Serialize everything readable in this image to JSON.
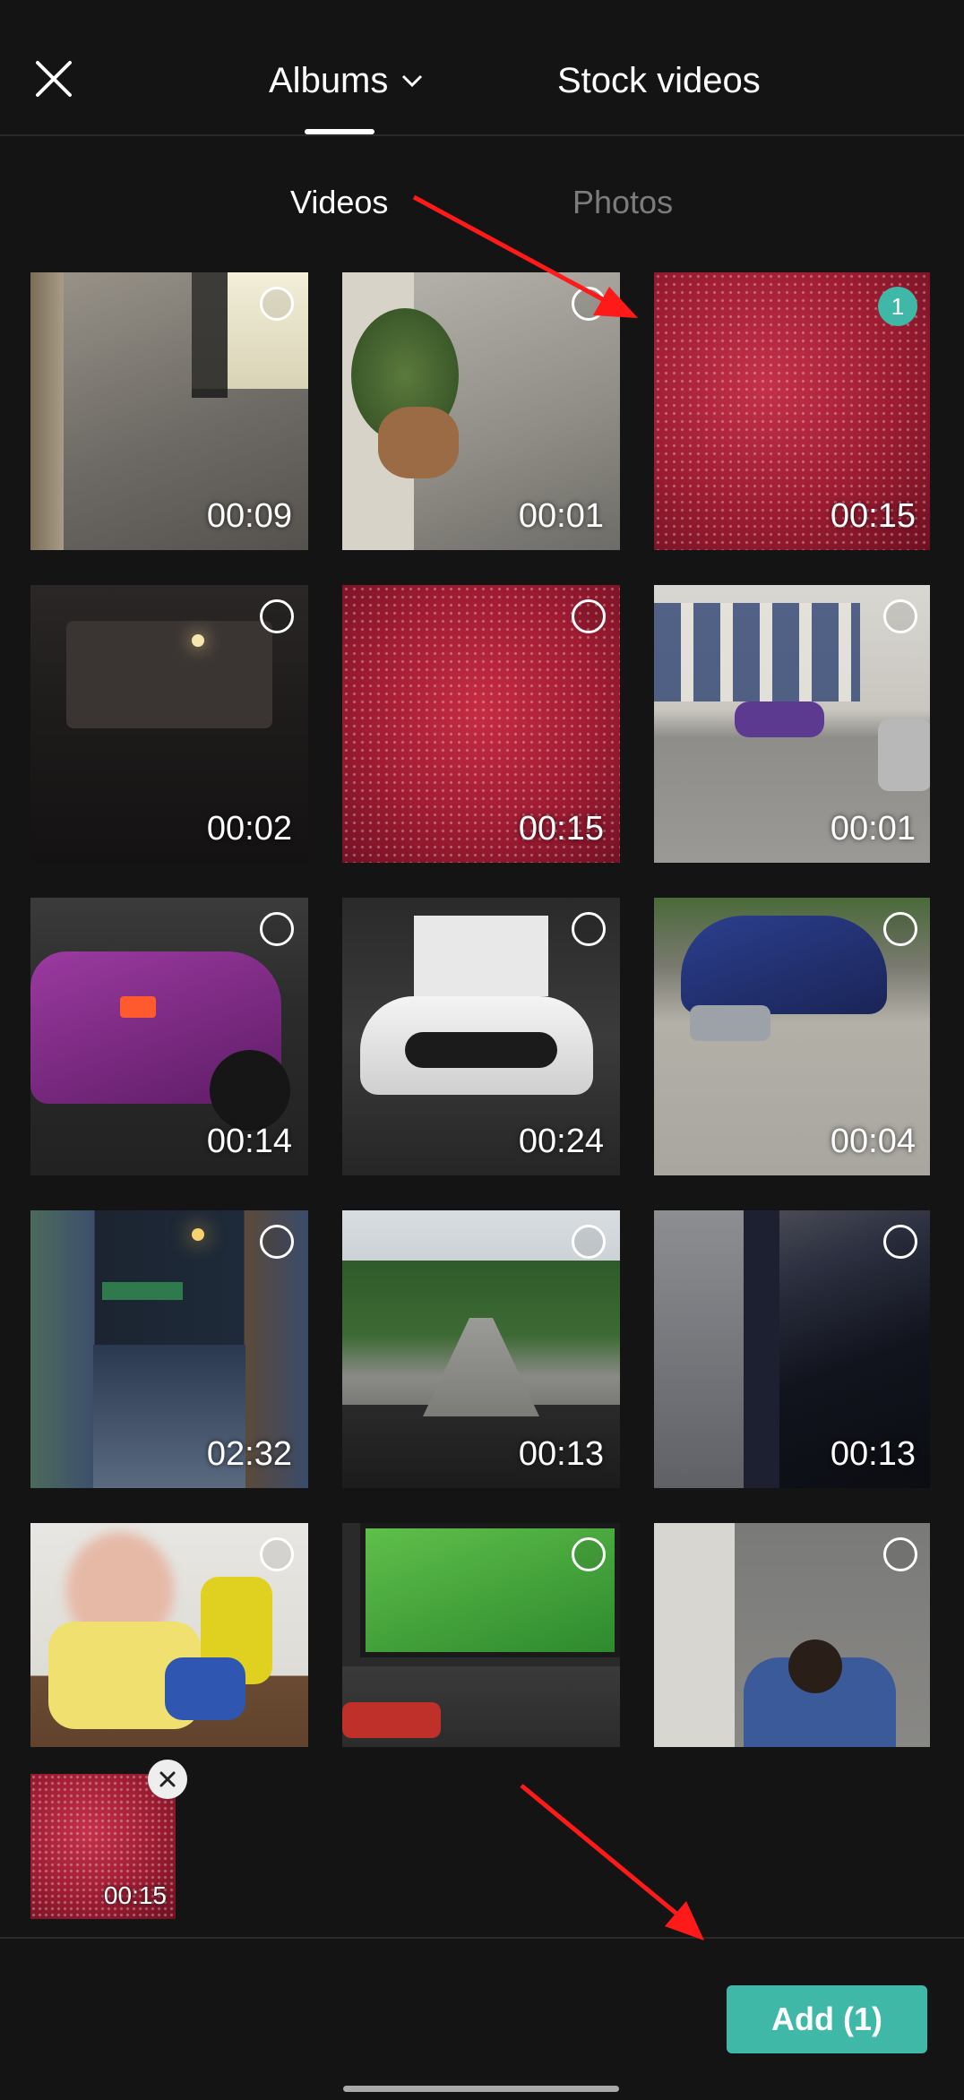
{
  "header": {
    "close_icon": "close-icon",
    "albums_label": "Albums",
    "albums_chevron_icon": "chevron-down-icon",
    "stock_label": "Stock videos"
  },
  "subtabs": {
    "videos": "Videos",
    "photos": "Photos"
  },
  "tiles": [
    {
      "duration": "00:09",
      "selected": false,
      "badge": ""
    },
    {
      "duration": "00:01",
      "selected": false,
      "badge": ""
    },
    {
      "duration": "00:15",
      "selected": true,
      "badge": "1"
    },
    {
      "duration": "00:02",
      "selected": false,
      "badge": ""
    },
    {
      "duration": "00:15",
      "selected": false,
      "badge": ""
    },
    {
      "duration": "00:01",
      "selected": false,
      "badge": ""
    },
    {
      "duration": "00:14",
      "selected": false,
      "badge": ""
    },
    {
      "duration": "00:24",
      "selected": false,
      "badge": ""
    },
    {
      "duration": "00:04",
      "selected": false,
      "badge": ""
    },
    {
      "duration": "02:32",
      "selected": false,
      "badge": ""
    },
    {
      "duration": "00:13",
      "selected": false,
      "badge": ""
    },
    {
      "duration": "00:13",
      "selected": false,
      "badge": ""
    },
    {
      "duration": "",
      "selected": false,
      "badge": ""
    },
    {
      "duration": "",
      "selected": false,
      "badge": ""
    },
    {
      "duration": "",
      "selected": false,
      "badge": ""
    }
  ],
  "selected_item": {
    "duration": "00:15",
    "remove_icon": "close-icon"
  },
  "add_button": {
    "label": "Add (1)"
  },
  "colors": {
    "accent": "#3fb8a7",
    "background": "#141414",
    "annotation_arrow": "#ff1a1a"
  }
}
